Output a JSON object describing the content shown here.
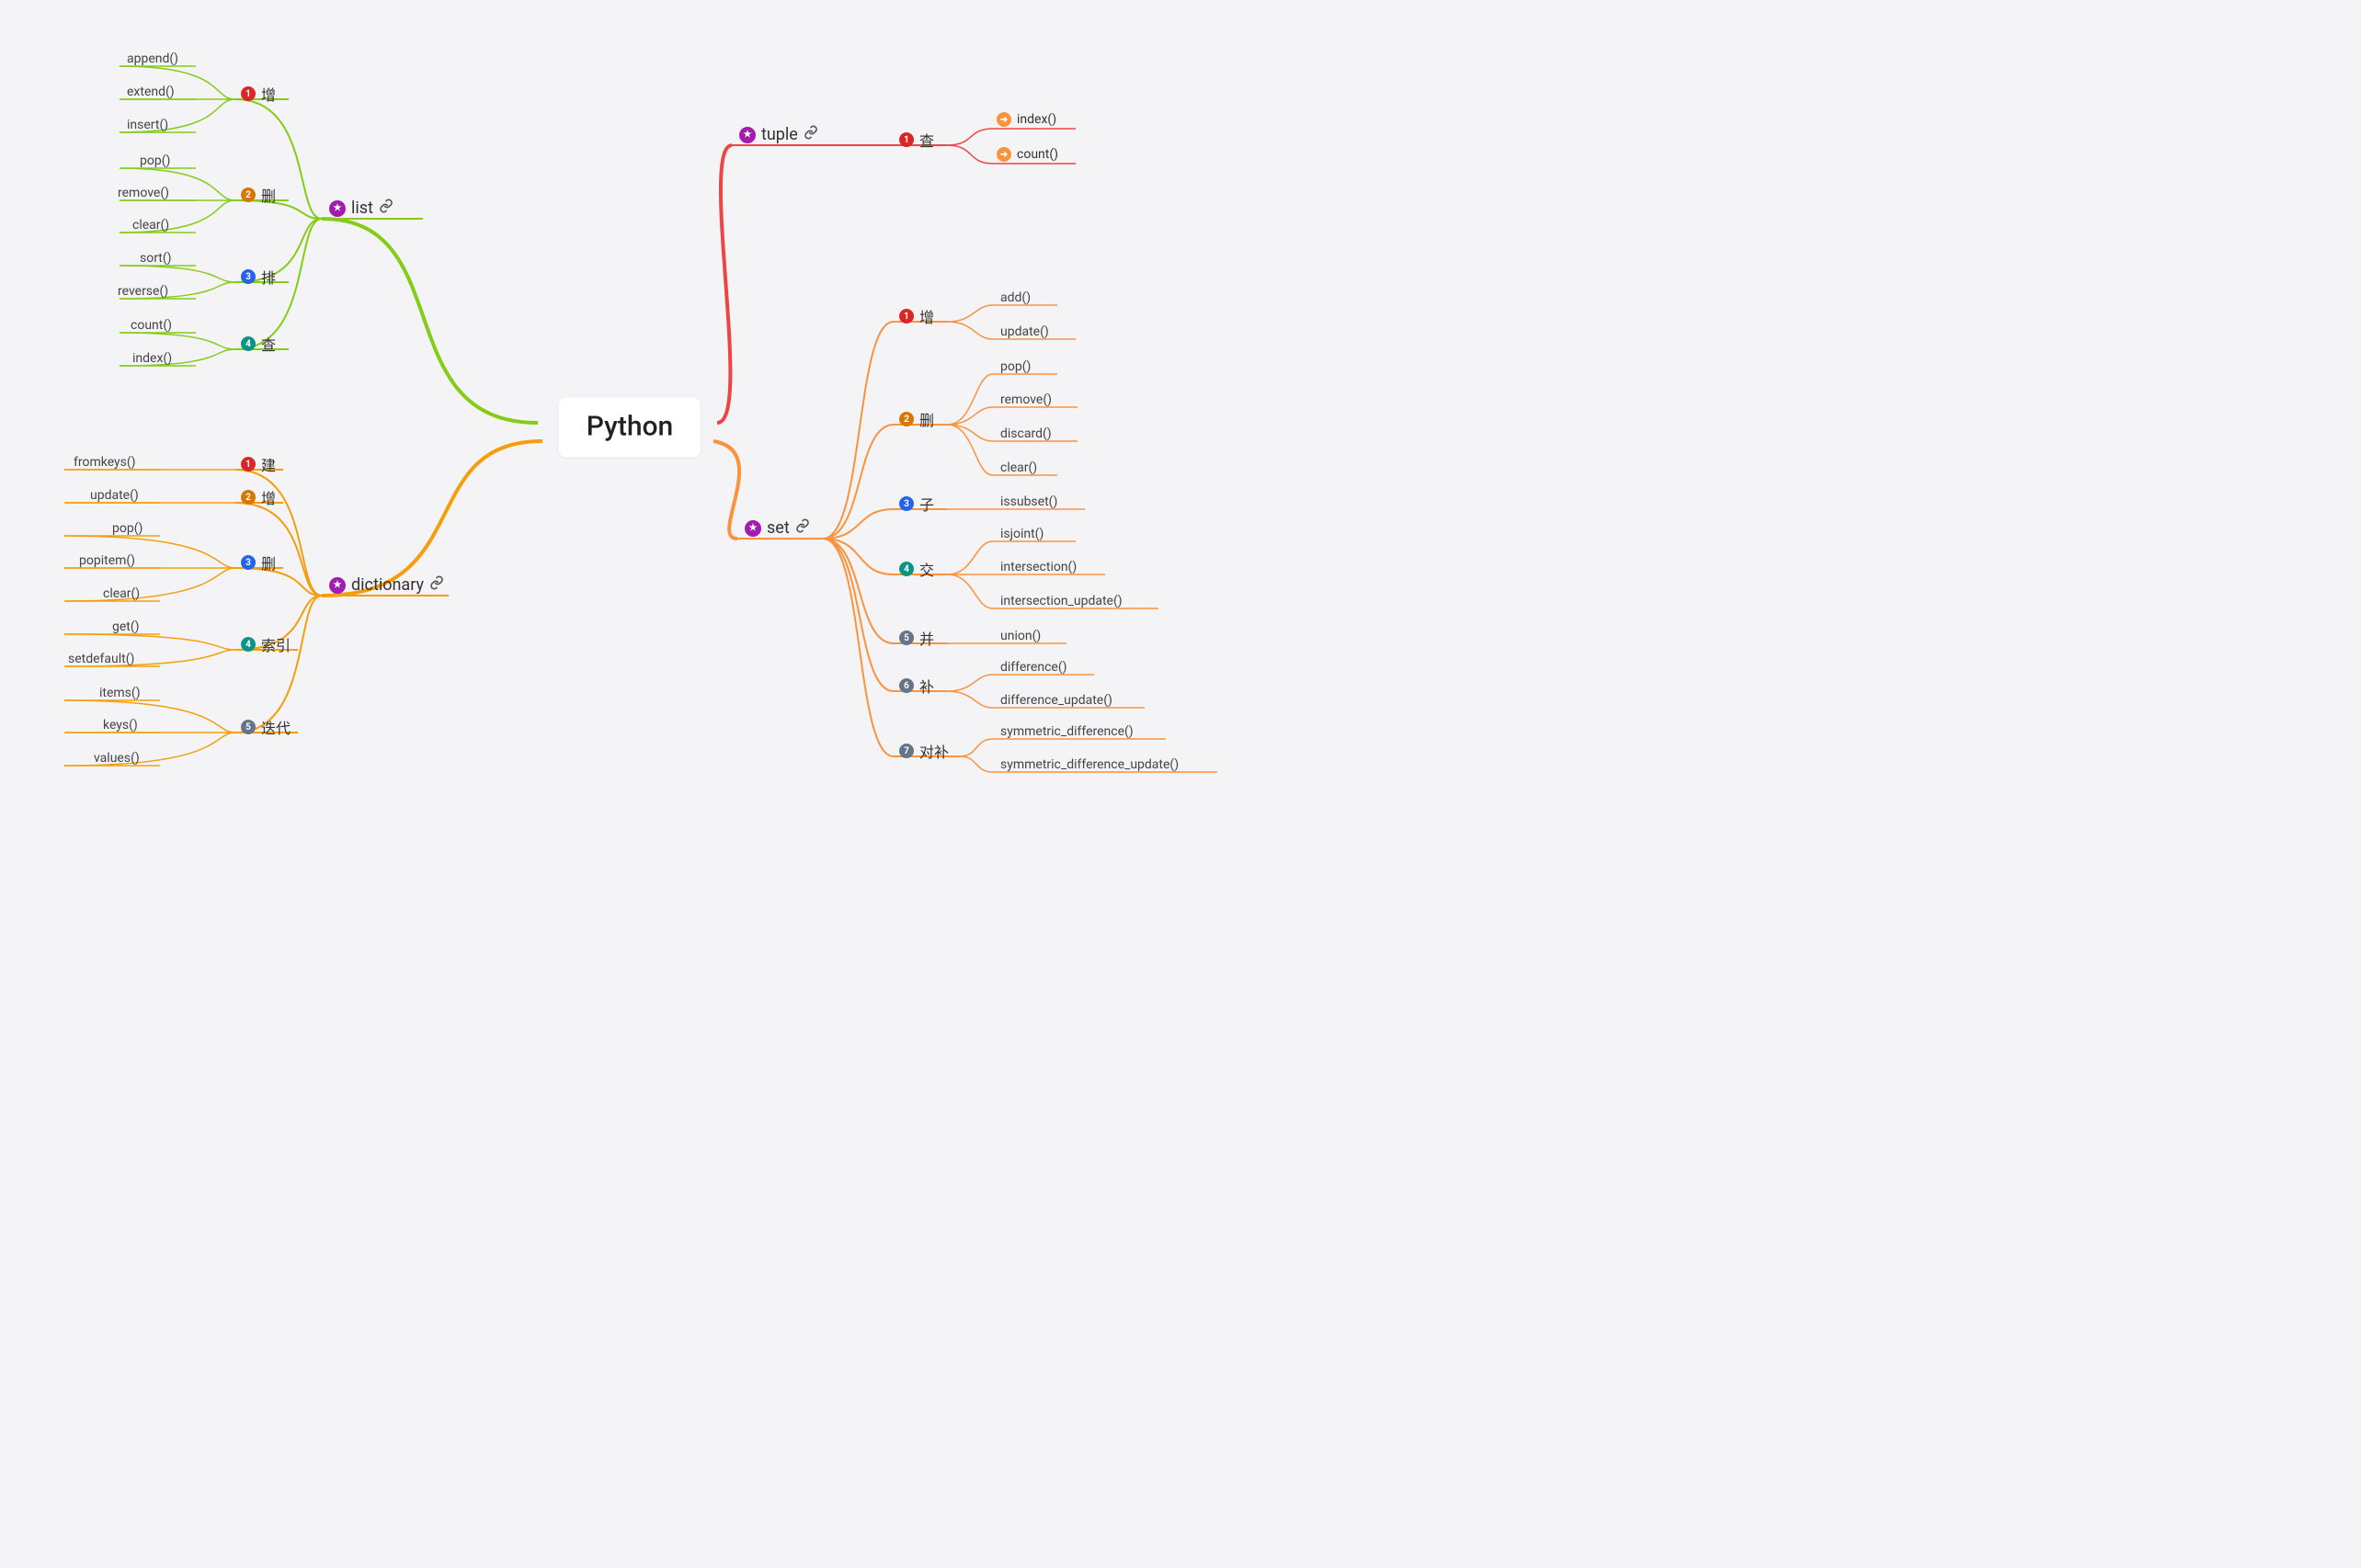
{
  "root": "Python",
  "branches": {
    "list": {
      "label": "list",
      "color": "#84cc16"
    },
    "tuple": {
      "label": "tuple",
      "color": "#ef4444"
    },
    "dictionary": {
      "label": "dictionary",
      "color": "#f59e0b"
    },
    "set": {
      "label": "set",
      "color": "#fb923c"
    }
  },
  "subs": {
    "list_add": {
      "label": "增",
      "num": "1",
      "color": "red"
    },
    "list_del": {
      "label": "删",
      "num": "2",
      "color": "amb"
    },
    "list_sort": {
      "label": "排",
      "num": "3",
      "color": "blue"
    },
    "list_find": {
      "label": "查",
      "num": "4",
      "color": "teal"
    },
    "tuple_find": {
      "label": "查",
      "num": "1",
      "color": "red"
    },
    "dict_build": {
      "label": "建",
      "num": "1",
      "color": "red"
    },
    "dict_add": {
      "label": "增",
      "num": "2",
      "color": "amb"
    },
    "dict_del": {
      "label": "删",
      "num": "3",
      "color": "blue"
    },
    "dict_idx": {
      "label": "索引",
      "num": "4",
      "color": "teal"
    },
    "dict_iter": {
      "label": "迭代",
      "num": "5",
      "color": "slate"
    },
    "set_add": {
      "label": "增",
      "num": "1",
      "color": "red"
    },
    "set_del": {
      "label": "删",
      "num": "2",
      "color": "amb"
    },
    "set_sub": {
      "label": "子",
      "num": "3",
      "color": "blue"
    },
    "set_int": {
      "label": "交",
      "num": "4",
      "color": "teal"
    },
    "set_uni": {
      "label": "并",
      "num": "5",
      "color": "slate"
    },
    "set_diff": {
      "label": "补",
      "num": "6",
      "color": "slate"
    },
    "set_sym": {
      "label": "对补",
      "num": "7",
      "color": "slate"
    }
  },
  "leaves": {
    "l_append": {
      "t": "append()"
    },
    "l_extend": {
      "t": "extend()"
    },
    "l_insert": {
      "t": "insert()"
    },
    "l_pop": {
      "t": "pop()"
    },
    "l_remove": {
      "t": "remove()"
    },
    "l_clear": {
      "t": "clear()"
    },
    "l_sort": {
      "t": "sort()"
    },
    "l_reverse": {
      "t": "reverse()"
    },
    "l_count": {
      "t": "count()"
    },
    "l_index": {
      "t": "index()"
    },
    "t_index": {
      "t": "index()",
      "arrow": true
    },
    "t_count": {
      "t": "count()",
      "arrow": true
    },
    "d_fromkeys": {
      "t": "fromkeys()"
    },
    "d_update": {
      "t": "update()"
    },
    "d_pop": {
      "t": "pop()"
    },
    "d_popitem": {
      "t": "popitem()"
    },
    "d_clear": {
      "t": "clear()"
    },
    "d_get": {
      "t": "get()"
    },
    "d_setdef": {
      "t": "setdefault()"
    },
    "d_items": {
      "t": "items()"
    },
    "d_keys": {
      "t": "keys()"
    },
    "d_values": {
      "t": "values()"
    },
    "s_add": {
      "t": "add()"
    },
    "s_update": {
      "t": "update()"
    },
    "s_pop": {
      "t": "pop()"
    },
    "s_remove": {
      "t": "remove()"
    },
    "s_discard": {
      "t": "discard()"
    },
    "s_clear": {
      "t": "clear()"
    },
    "s_issubset": {
      "t": "issubset()"
    },
    "s_isjoint": {
      "t": "isjoint()"
    },
    "s_inter": {
      "t": "intersection()"
    },
    "s_interup": {
      "t": "intersection_update()"
    },
    "s_union": {
      "t": "union()"
    },
    "s_diff": {
      "t": "difference()"
    },
    "s_diffup": {
      "t": "difference_update()"
    },
    "s_sym": {
      "t": "symmetric_difference()"
    },
    "s_symup": {
      "t": "symmetric_difference_update()"
    }
  }
}
